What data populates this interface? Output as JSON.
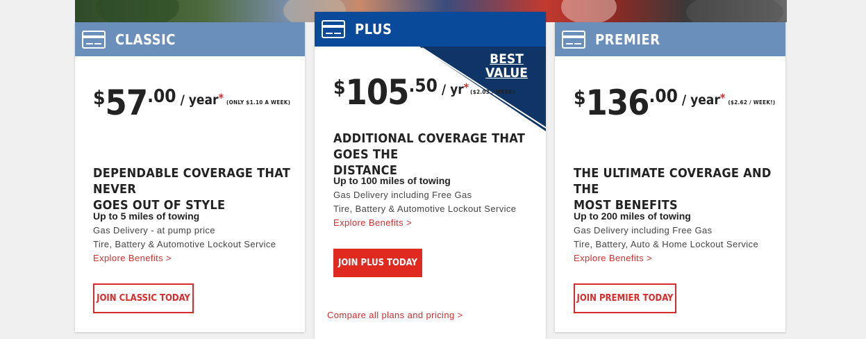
{
  "plans": {
    "classic": {
      "name": "CLASSIC",
      "icon": "credit-card-icon",
      "currency": "$",
      "price_whole": "57",
      "price_cents": ".00",
      "per": "/ year",
      "asterisk": "*",
      "weekly": "(ONLY $1.10 A WEEK)",
      "tagline_line1": "DEPENDABLE COVERAGE THAT NEVER",
      "tagline_line2": "GOES OUT OF STYLE",
      "towing": "Up to 5 miles of towing",
      "feature_1": "Gas Delivery - at pump price",
      "feature_2": "Tire, Battery & Automotive Lockout Service",
      "explore": "Explore Benefits >",
      "cta": "JOIN CLASSIC TODAY"
    },
    "plus": {
      "name": "PLUS",
      "icon": "credit-card-icon",
      "currency": "$",
      "price_whole": "105",
      "price_cents": ".50",
      "per": "/ yr",
      "asterisk": "*",
      "weekly": "($2.03 / WEEK)",
      "badge_line1": "BEST",
      "badge_line2": "VALUE",
      "tagline_line1": "ADDITIONAL COVERAGE THAT GOES THE",
      "tagline_line2": "DISTANCE",
      "towing": "Up to 100 miles of towing",
      "feature_1": "Gas Delivery including Free Gas",
      "feature_2": "Tire, Battery & Automotive Lockout Service",
      "explore": "Explore Benefits >",
      "cta": "JOIN PLUS TODAY",
      "compare": "Compare all plans and pricing >"
    },
    "premier": {
      "name": "PREMIER",
      "icon": "credit-card-icon",
      "currency": "$",
      "price_whole": "136",
      "price_cents": ".00",
      "per": "/ year",
      "asterisk": "*",
      "weekly": "($2.62 / WEEK!)",
      "tagline_line1": "THE ULTIMATE COVERAGE AND THE",
      "tagline_line2": "MOST BENEFITS",
      "towing": "Up to 200 miles of towing",
      "feature_1": "Gas Delivery including Free Gas",
      "feature_2": "Tire, Battery, Auto & Home Lockout Service",
      "explore": "Explore Benefits >",
      "cta": "JOIN PREMIER TODAY"
    }
  },
  "colors": {
    "accent_red": "#d92b2b",
    "header_light_blue": "#6b8fbb",
    "header_plus_blue": "#0a4a9a",
    "ribbon_navy": "#0e3566"
  }
}
